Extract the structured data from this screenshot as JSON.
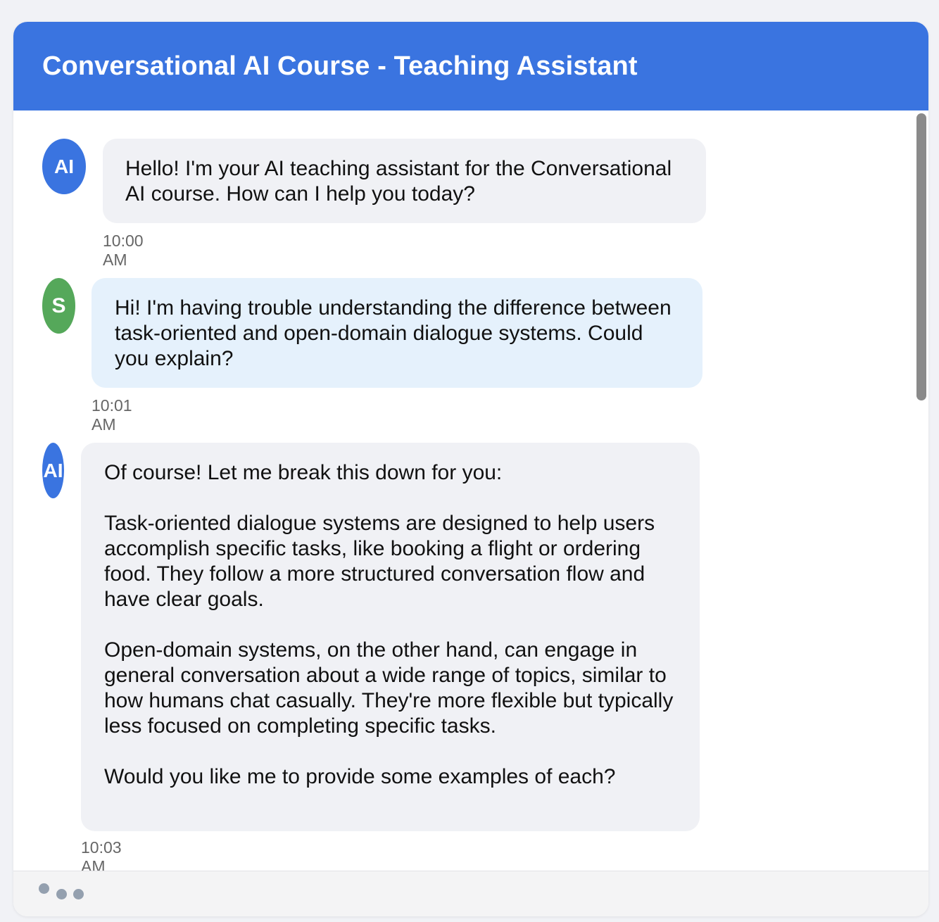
{
  "header": {
    "title": "Conversational AI Course - Teaching Assistant"
  },
  "messages": [
    {
      "sender": "ai",
      "avatar": "AI",
      "text": "Hello! I'm your AI teaching assistant for the Conversational AI course. How can I help you today?",
      "time": "10:00 AM"
    },
    {
      "sender": "student",
      "avatar": "S",
      "text": "Hi! I'm having trouble understanding the difference between task-oriented and open-domain dialogue systems. Could you explain?",
      "time": "10:01 AM"
    },
    {
      "sender": "ai",
      "avatar": "AI",
      "text": "Of course! Let me break this down for you:\n\nTask-oriented dialogue systems are designed to help users accomplish specific tasks, like booking a flight or ordering food. They follow a more structured conversation flow and have clear goals.\n\nOpen-domain systems, on the other hand, can engage in general conversation about a wide range of topics, similar to how humans chat casually. They're more flexible but typically less focused on completing specific tasks.\n\nWould you like me to provide some examples of each?",
      "time": "10:03 AM"
    }
  ],
  "footer": {
    "typing_indicator": "typing-dots-icon"
  },
  "colors": {
    "header": "#3a74e0",
    "ai_avatar": "#3a74e0",
    "student_avatar": "#55a85a",
    "ai_bubble": "#f0f1f5",
    "student_bubble": "#e5f1fc"
  }
}
